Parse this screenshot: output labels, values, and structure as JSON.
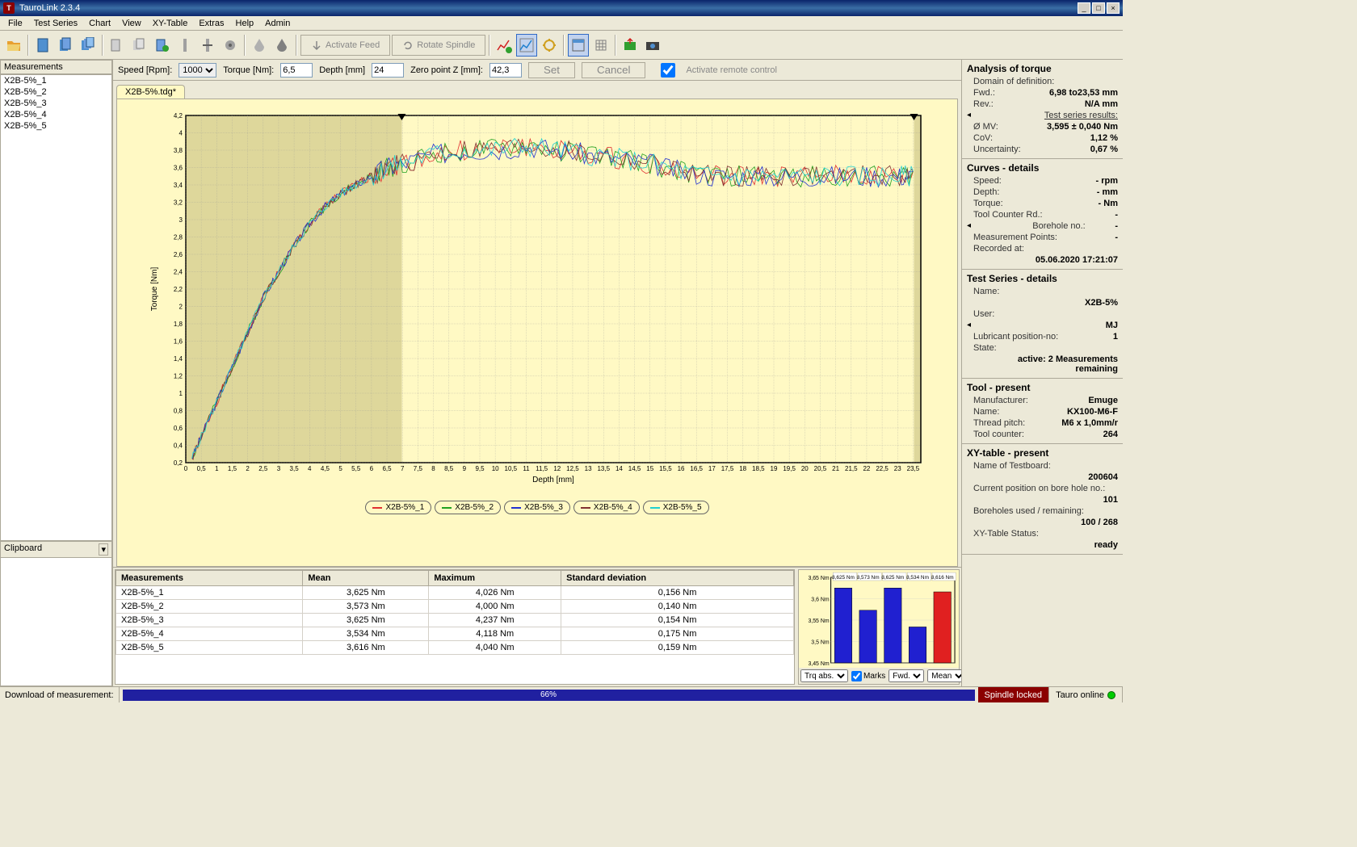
{
  "app": {
    "title": "TauroLink 2.3.4"
  },
  "menu": {
    "items": [
      "File",
      "Test Series",
      "Chart",
      "View",
      "XY-Table",
      "Extras",
      "Help",
      "Admin"
    ]
  },
  "toolbar": {
    "activate_feed": "Activate Feed",
    "rotate_spindle": "Rotate Spindle",
    "remote_label": "Activate remote control"
  },
  "params": {
    "speed_label": "Speed [Rpm]:",
    "speed": "1000",
    "torque_label": "Torque [Nm]:",
    "torque": "6,5",
    "depth_label": "Depth [mm]",
    "depth": "24",
    "zero_label": "Zero point Z [mm]:",
    "zero": "42,3",
    "set": "Set",
    "cancel": "Cancel"
  },
  "left": {
    "meas_header": "Measurements",
    "items": [
      "X2B-5%_1",
      "X2B-5%_2",
      "X2B-5%_3",
      "X2B-5%_4",
      "X2B-5%_5"
    ],
    "clipboard": "Clipboard"
  },
  "tab": "X2B-5%.tdg*",
  "chart": {
    "ylabel": "Torque [Nm]",
    "xlabel": "Depth [mm]"
  },
  "chart_data": {
    "type": "line",
    "xlabel": "Depth [mm]",
    "ylabel": "Torque [Nm]",
    "xlim": [
      0,
      23.75
    ],
    "ylim": [
      0.2,
      4.2
    ],
    "xticks": [
      0,
      0.5,
      1,
      1.5,
      2,
      2.5,
      3,
      3.5,
      4,
      4.5,
      5,
      5.5,
      6,
      6.5,
      7,
      7.5,
      8,
      8.5,
      9,
      9.5,
      10,
      10.5,
      11,
      11.5,
      12,
      12.5,
      13,
      13.5,
      14,
      14.5,
      15,
      15.5,
      16,
      16.5,
      17,
      17.5,
      18,
      18.5,
      19,
      19.5,
      20,
      20.5,
      21,
      21.5,
      22,
      22.5,
      23,
      23.5
    ],
    "yticks": [
      0.2,
      0.4,
      0.6,
      0.8,
      1,
      1.2,
      1.4,
      1.6,
      1.8,
      2,
      2.2,
      2.4,
      2.6,
      2.8,
      3,
      3.2,
      3.4,
      3.6,
      3.8,
      4,
      4.2
    ],
    "shade_range": [
      6.98,
      23.53
    ],
    "markers_x": [
      6.98,
      23.53
    ],
    "series": [
      {
        "name": "X2B-5%_1",
        "color": "#e03030"
      },
      {
        "name": "X2B-5%_2",
        "color": "#20a020"
      },
      {
        "name": "X2B-5%_3",
        "color": "#2030d0"
      },
      {
        "name": "X2B-5%_4",
        "color": "#803030"
      },
      {
        "name": "X2B-5%_5",
        "color": "#20d0d0"
      }
    ],
    "approx_curve": [
      {
        "x": 0.2,
        "y": 0.25
      },
      {
        "x": 0.5,
        "y": 0.5
      },
      {
        "x": 1,
        "y": 0.9
      },
      {
        "x": 1.5,
        "y": 1.3
      },
      {
        "x": 2,
        "y": 1.7
      },
      {
        "x": 2.5,
        "y": 2.1
      },
      {
        "x": 3,
        "y": 2.4
      },
      {
        "x": 3.5,
        "y": 2.7
      },
      {
        "x": 4,
        "y": 2.95
      },
      {
        "x": 4.5,
        "y": 3.15
      },
      {
        "x": 5,
        "y": 3.3
      },
      {
        "x": 5.5,
        "y": 3.4
      },
      {
        "x": 6,
        "y": 3.5
      },
      {
        "x": 6.5,
        "y": 3.6
      },
      {
        "x": 7,
        "y": 3.65
      },
      {
        "x": 8,
        "y": 3.75
      },
      {
        "x": 9,
        "y": 3.8
      },
      {
        "x": 10,
        "y": 3.8
      },
      {
        "x": 11,
        "y": 3.85
      },
      {
        "x": 12,
        "y": 3.8
      },
      {
        "x": 13,
        "y": 3.75
      },
      {
        "x": 14,
        "y": 3.7
      },
      {
        "x": 15,
        "y": 3.65
      },
      {
        "x": 16,
        "y": 3.55
      },
      {
        "x": 17,
        "y": 3.5
      },
      {
        "x": 18,
        "y": 3.5
      },
      {
        "x": 19,
        "y": 3.5
      },
      {
        "x": 20,
        "y": 3.5
      },
      {
        "x": 21,
        "y": 3.5
      },
      {
        "x": 22,
        "y": 3.5
      },
      {
        "x": 23,
        "y": 3.5
      },
      {
        "x": 23.5,
        "y": 3.5
      }
    ]
  },
  "table": {
    "headers": [
      "Measurements",
      "Mean",
      "Maximum",
      "Standard deviation"
    ],
    "rows": [
      [
        "X2B-5%_1",
        "3,625 Nm",
        "4,026 Nm",
        "0,156 Nm"
      ],
      [
        "X2B-5%_2",
        "3,573 Nm",
        "4,000 Nm",
        "0,140 Nm"
      ],
      [
        "X2B-5%_3",
        "3,625 Nm",
        "4,237 Nm",
        "0,154 Nm"
      ],
      [
        "X2B-5%_4",
        "3,534 Nm",
        "4,118 Nm",
        "0,175 Nm"
      ],
      [
        "X2B-5%_5",
        "3,616 Nm",
        "4,040 Nm",
        "0,159 Nm"
      ]
    ]
  },
  "minichart": {
    "type": "bar",
    "ylim": [
      3.45,
      3.65
    ],
    "yticks": [
      "3,45 Nm",
      "3,5 Nm",
      "3,55 Nm",
      "3,6 Nm",
      "3,65 Nm"
    ],
    "bars": [
      {
        "label": "3,625 Nm",
        "value": 3.625,
        "color": "#2020d0"
      },
      {
        "label": "3,573 Nm",
        "value": 3.573,
        "color": "#2020d0"
      },
      {
        "label": "3,625 Nm",
        "value": 3.625,
        "color": "#2020d0"
      },
      {
        "label": "3,534 Nm",
        "value": 3.534,
        "color": "#2020d0"
      },
      {
        "label": "3,616 Nm",
        "value": 3.616,
        "color": "#e02020"
      }
    ],
    "ctl": {
      "trq": "Trq abs.",
      "marks": "Marks",
      "fwd": "Fwd.",
      "mean": "Mean"
    }
  },
  "right": {
    "h1": "Analysis of torque",
    "domain": "Domain of definition:",
    "fwd_l": "Fwd.:",
    "fwd_v": "6,98 to23,53  mm",
    "rev_l": "Rev.:",
    "rev_v": "N/A  mm",
    "tsr": "Test series results:",
    "mv_l": "Ø MV:",
    "mv_v": "3,595 ± 0,040  Nm",
    "cov_l": "CoV:",
    "cov_v": "1,12  %",
    "unc_l": "Uncertainty:",
    "unc_v": "0,67  %",
    "h2": "Curves - details",
    "speed_l": "Speed:",
    "speed_v": "-  rpm",
    "depth_l": "Depth:",
    "depth_v": "-  mm",
    "torque_l": "Torque:",
    "torque_v": "-  Nm",
    "tcr_l": "Tool Counter Rd.:",
    "tcr_v": "-",
    "bh_l": "Borehole no.:",
    "bh_v": "-",
    "mp_l": "Measurement Points:",
    "mp_v": "-",
    "rec_l": "Recorded at:",
    "rec_v": "05.06.2020 17:21:07",
    "h3": "Test Series - details",
    "name_l": "Name:",
    "name_v": "X2B-5%",
    "user_l": "User:",
    "user_v": "MJ",
    "lub_l": "Lubricant position-no:",
    "lub_v": "1",
    "state_l": "State:",
    "state_v": "active: 2 Measurements remaining",
    "h4": "Tool - present",
    "manu_l": "Manufacturer:",
    "manu_v": "Emuge",
    "tname_l": "Name:",
    "tname_v": "KX100-M6-F",
    "pitch_l": "Thread pitch:",
    "pitch_v": "M6 x  1,0mm/r",
    "tc_l": "Tool counter:",
    "tc_v": "264",
    "h5": "XY-table - present",
    "tb_l": "Name of Testboard:",
    "tb_v": "200604",
    "cp_l": "Current position on bore hole no.:",
    "cp_v": "101",
    "bur_l": "Boreholes used / remaining:",
    "bur_v": "100 / 268",
    "xys_l": "XY-Table Status:",
    "xys_v": "ready"
  },
  "status": {
    "dl": "Download of measurement:",
    "pct": "66%",
    "spindle": "Spindle locked",
    "online": "Tauro online"
  }
}
